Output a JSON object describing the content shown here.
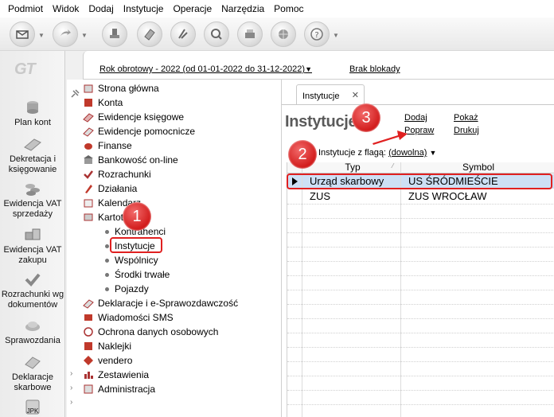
{
  "menu": [
    "Podmiot",
    "Widok",
    "Dodaj",
    "Instytucje",
    "Operacje",
    "Narzędzia",
    "Pomoc"
  ],
  "toolbar_icons": [
    "mail-icon",
    "forward-icon",
    "stamp-icon",
    "eraser-icon",
    "chart-icon",
    "magnifier-icon",
    "printer-icon",
    "globe-icon",
    "help-icon"
  ],
  "sidebar": {
    "logo": "GT",
    "items": [
      {
        "label": "Plan kont",
        "icon": "coins-icon"
      },
      {
        "label": "Dekretacja i księgowanie",
        "icon": "book-icon"
      },
      {
        "label": "Ewidencja VAT sprzedaży",
        "icon": "coins-stack-icon"
      },
      {
        "label": "Ewidencja VAT zakupu",
        "icon": "boxes-icon"
      },
      {
        "label": "Rozrachunki wg dokumentów",
        "icon": "check-icon"
      },
      {
        "label": "Sprawozdania",
        "icon": "report-icon"
      },
      {
        "label": "Deklaracje skarbowe",
        "icon": "declaration-icon"
      },
      {
        "label": "JPK",
        "icon": "jpk-icon"
      }
    ]
  },
  "infobar": {
    "fiscal_year": "Rok obrotowy - 2022  (od 01-01-2022 do 31-12-2022)",
    "lock": "Brak blokady"
  },
  "tree": {
    "items": [
      {
        "label": "Strona główna",
        "icon": "home-icon"
      },
      {
        "label": "Konta",
        "icon": "accounts-icon"
      },
      {
        "label": "Ewidencje księgowe",
        "icon": "ledger-icon"
      },
      {
        "label": "Ewidencje pomocnicze",
        "icon": "ledger-aux-icon"
      },
      {
        "label": "Finanse",
        "icon": "finance-icon"
      },
      {
        "label": "Bankowość on-line",
        "icon": "bank-icon"
      },
      {
        "label": "Rozrachunki",
        "icon": "settlements-icon"
      },
      {
        "label": "Działania",
        "icon": "actions-icon"
      },
      {
        "label": "Kalendarz",
        "icon": "calendar-icon"
      },
      {
        "label": "Kartoteki",
        "icon": "cards-icon"
      }
    ],
    "sub_items": [
      "Kontrahenci",
      "Instytucje",
      "Wspólnicy",
      "Środki trwałe",
      "Pojazdy"
    ],
    "items_after": [
      {
        "label": "Deklaracje i e-Sprawozdawczość",
        "icon": "declarations-icon"
      },
      {
        "label": "Wiadomości SMS",
        "icon": "sms-icon"
      },
      {
        "label": "Ochrona danych osobowych",
        "icon": "privacy-icon"
      },
      {
        "label": "Naklejki",
        "icon": "stickers-icon"
      },
      {
        "label": "vendero",
        "icon": "vendero-icon"
      },
      {
        "label": "Zestawienia",
        "icon": "summary-icon"
      },
      {
        "label": "Administracja",
        "icon": "admin-icon"
      }
    ]
  },
  "content": {
    "tab_label": "Instytucje",
    "tab_close": "✕",
    "title": "Instytucje",
    "links": {
      "add": "Dodaj",
      "edit": "Popraw",
      "show": "Pokaż",
      "print": "Drukuj"
    },
    "flag_label": "Instytucje z flagą:",
    "flag_value": "(dowolna)",
    "columns": [
      "Typ",
      "Symbol"
    ],
    "rows": [
      {
        "type": "Urząd skarbowy",
        "symbol": "US ŚRÓDMIEŚCIE"
      },
      {
        "type": "ZUS",
        "symbol": "ZUS WROCŁAW"
      }
    ]
  },
  "callouts": [
    "1",
    "2",
    "3"
  ]
}
